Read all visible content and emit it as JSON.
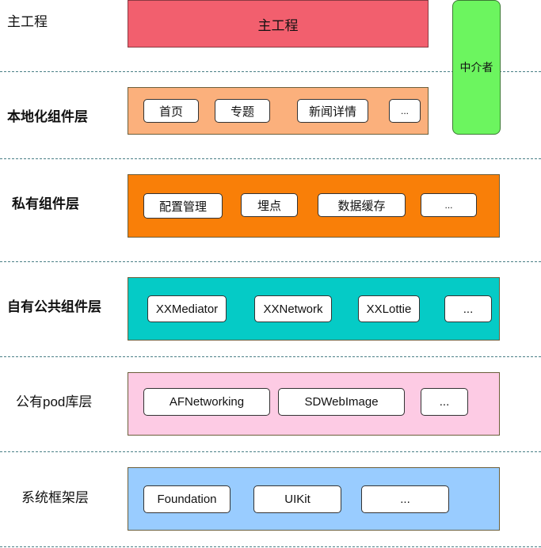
{
  "colors": {
    "main": "#f25f6e",
    "mediator": "#6cf55f",
    "local": "#fbb07c",
    "private": "#f97f08",
    "own_public": "#05cbc6",
    "pod": "#fdcbe4",
    "system": "#99ccff"
  },
  "layers": {
    "main": {
      "label": "主工程",
      "box_text": "主工程"
    },
    "local": {
      "label": "本地化组件层",
      "items": [
        "首页",
        "专题",
        "新闻详情",
        "..."
      ]
    },
    "private": {
      "label": "私有组件层",
      "items": [
        "配置管理",
        "埋点",
        "数据缓存",
        "..."
      ]
    },
    "own_public": {
      "label": "自有公共组件层",
      "items": [
        "XXMediator",
        "XXNetwork",
        "XXLottie",
        "..."
      ]
    },
    "pod": {
      "label": "公有pod库层",
      "items": [
        "AFNetworking",
        "SDWebImage",
        "..."
      ]
    },
    "system": {
      "label": "系统框架层",
      "items": [
        "Foundation",
        "UIKit",
        "..."
      ]
    }
  },
  "mediator": {
    "label": "中介者"
  }
}
